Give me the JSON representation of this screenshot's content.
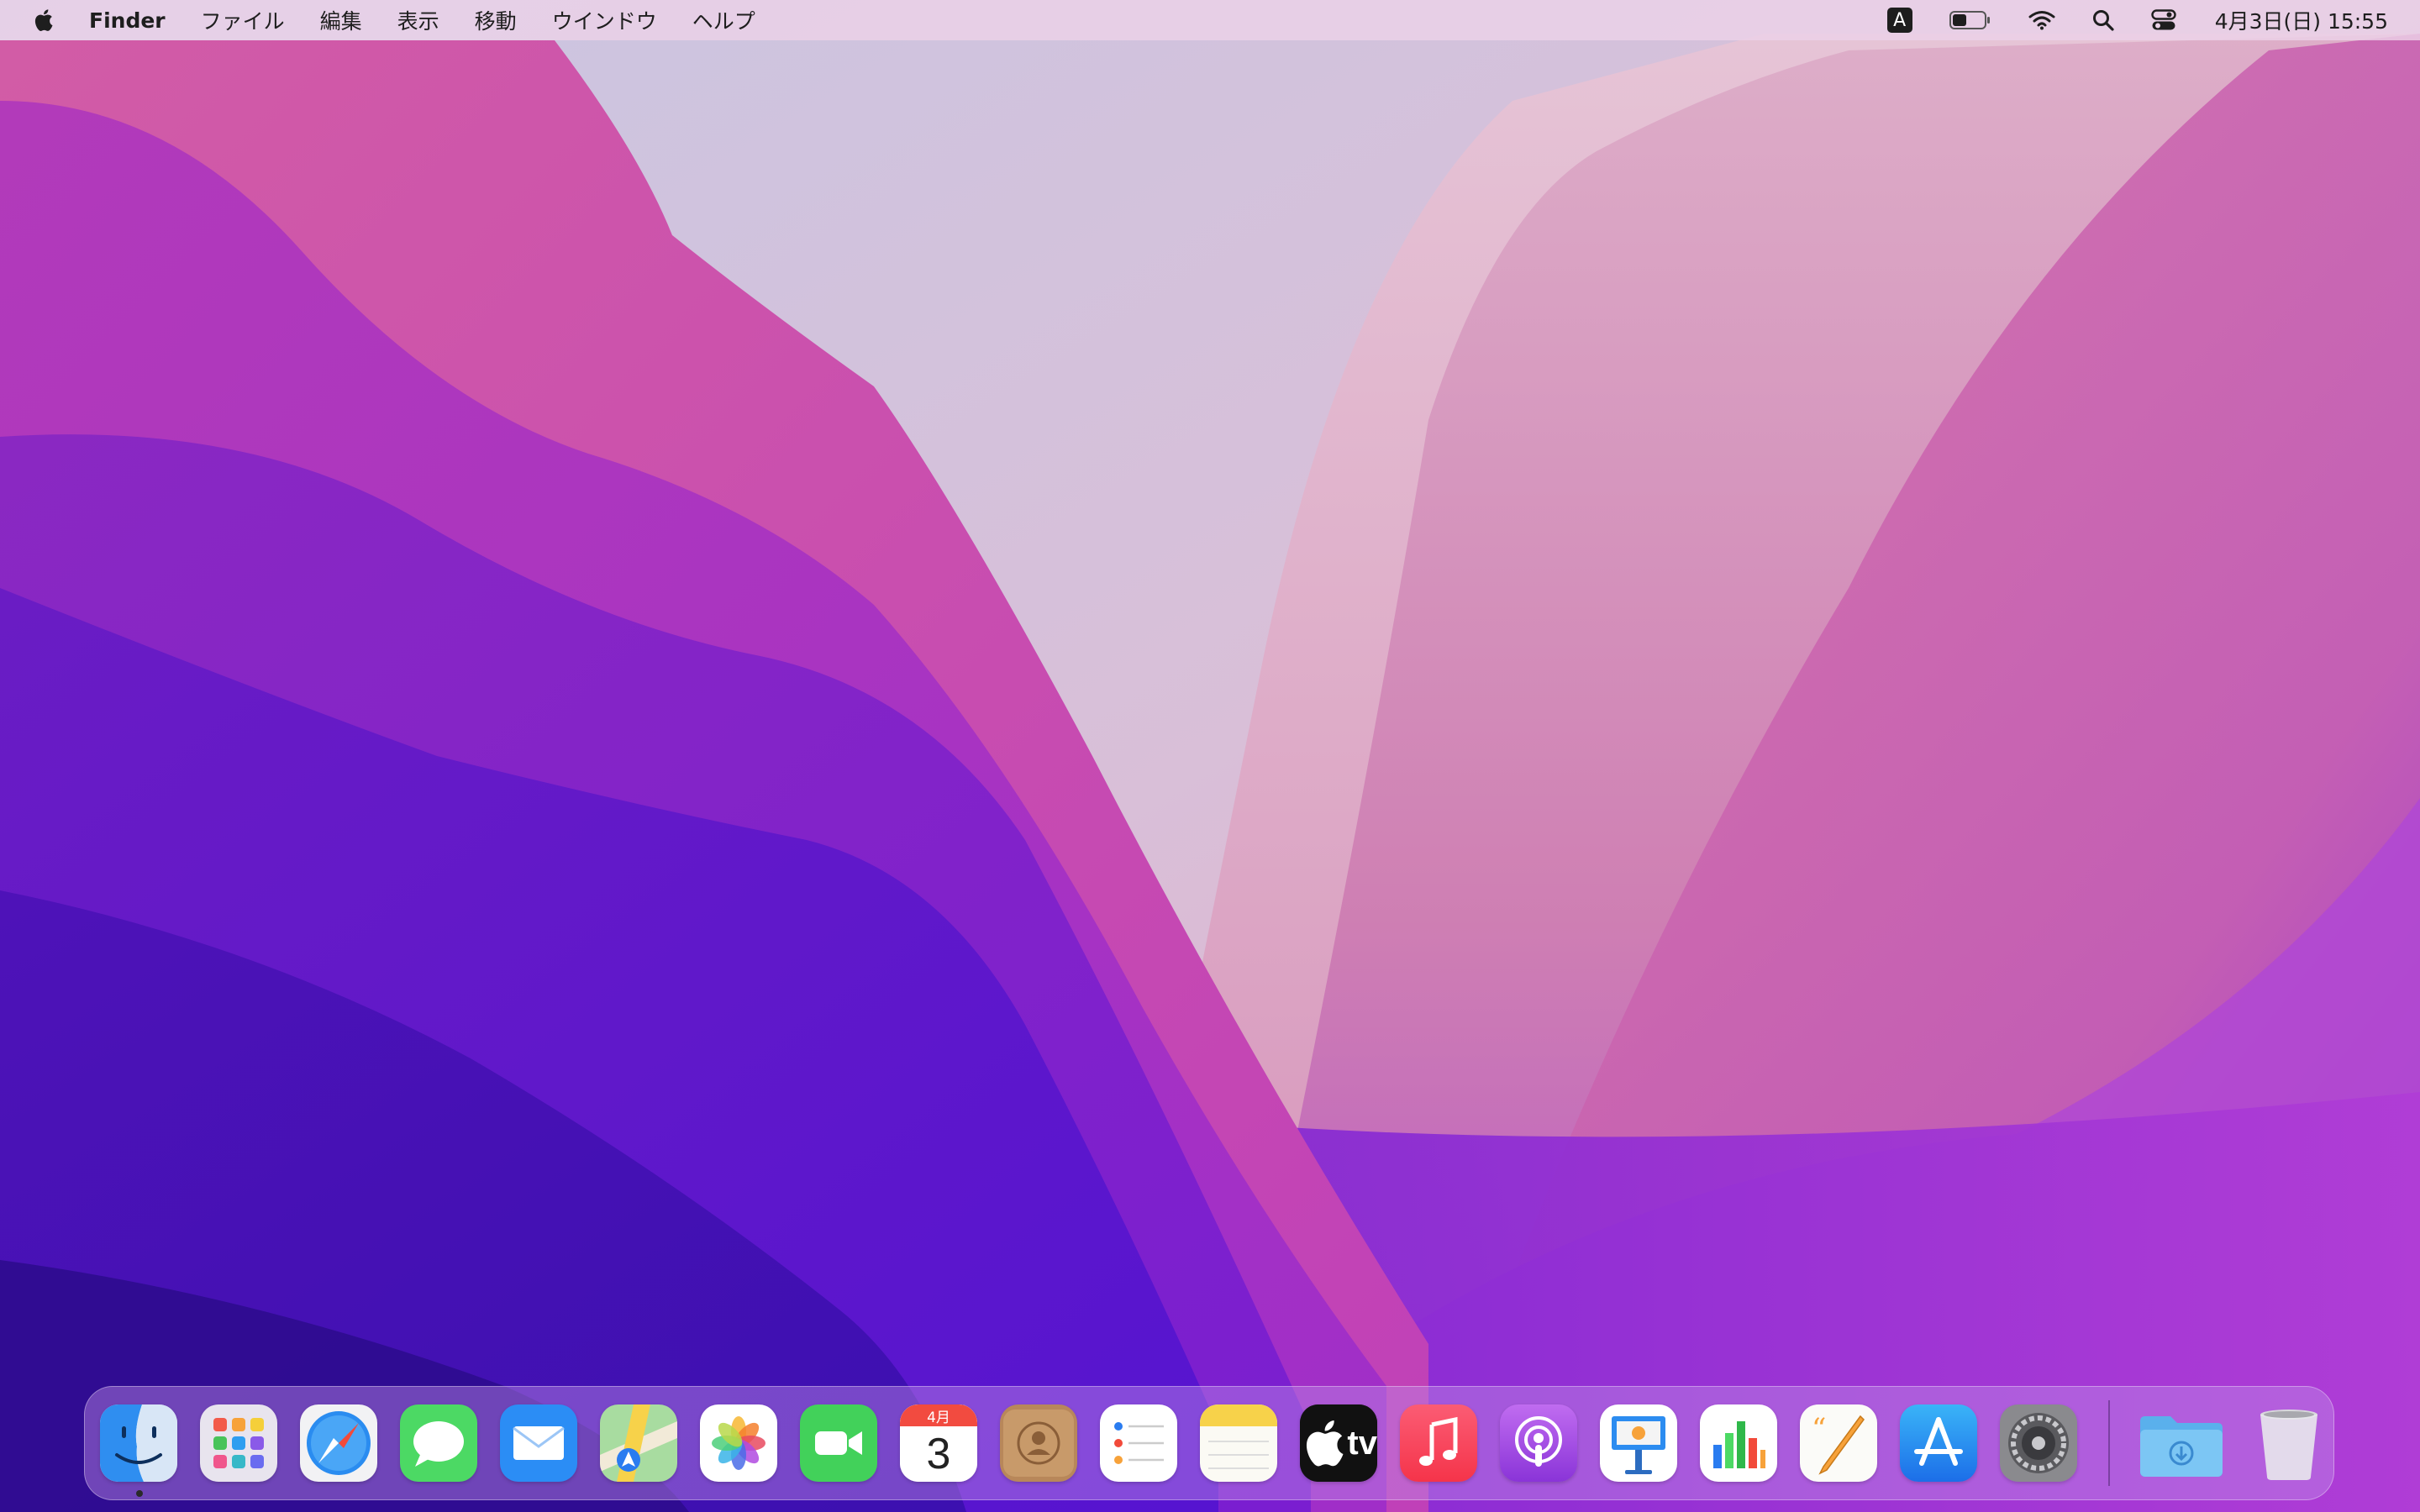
{
  "menubar": {
    "app_name": "Finder",
    "menus": [
      "ファイル",
      "編集",
      "表示",
      "移動",
      "ウインドウ",
      "ヘルプ"
    ],
    "input_source": "A",
    "clock": "4月3日(日)  15:55",
    "icons": [
      "apple-icon",
      "input-source-icon",
      "battery-icon",
      "wifi-icon",
      "spotlight-search-icon",
      "control-center-icon"
    ]
  },
  "colors": {
    "menubar_bg": "#ECD2E8",
    "wallpaper_purple": "#4A12C4",
    "wallpaper_magenta": "#C440B0",
    "wallpaper_pink": "#D98AB0",
    "calendar_red": "#F24B40"
  },
  "dock": {
    "apps": [
      {
        "name": "Finder",
        "icon": "finder-icon",
        "running": true
      },
      {
        "name": "Launchpad",
        "icon": "launchpad-icon"
      },
      {
        "name": "Safari",
        "icon": "safari-icon"
      },
      {
        "name": "Messages",
        "icon": "messages-icon"
      },
      {
        "name": "Mail",
        "icon": "mail-icon"
      },
      {
        "name": "Maps",
        "icon": "maps-icon"
      },
      {
        "name": "Photos",
        "icon": "photos-icon"
      },
      {
        "name": "FaceTime",
        "icon": "facetime-icon"
      },
      {
        "name": "Calendar",
        "icon": "calendar-icon"
      },
      {
        "name": "Contacts",
        "icon": "contacts-icon"
      },
      {
        "name": "Reminders",
        "icon": "reminders-icon"
      },
      {
        "name": "Notes",
        "icon": "notes-icon"
      },
      {
        "name": "TV",
        "icon": "apple-tv-icon"
      },
      {
        "name": "Music",
        "icon": "music-icon"
      },
      {
        "name": "Podcasts",
        "icon": "podcasts-icon"
      },
      {
        "name": "Keynote",
        "icon": "keynote-icon"
      },
      {
        "name": "Numbers",
        "icon": "numbers-icon"
      },
      {
        "name": "Pages",
        "icon": "pages-icon"
      },
      {
        "name": "App Store",
        "icon": "app-store-icon"
      },
      {
        "name": "System Preferences",
        "icon": "system-preferences-icon"
      }
    ],
    "calendar_month": "4月",
    "calendar_day": "3",
    "tv_label": "tv",
    "others": [
      {
        "name": "Downloads",
        "icon": "downloads-folder-icon"
      },
      {
        "name": "Trash",
        "icon": "trash-icon"
      }
    ]
  }
}
